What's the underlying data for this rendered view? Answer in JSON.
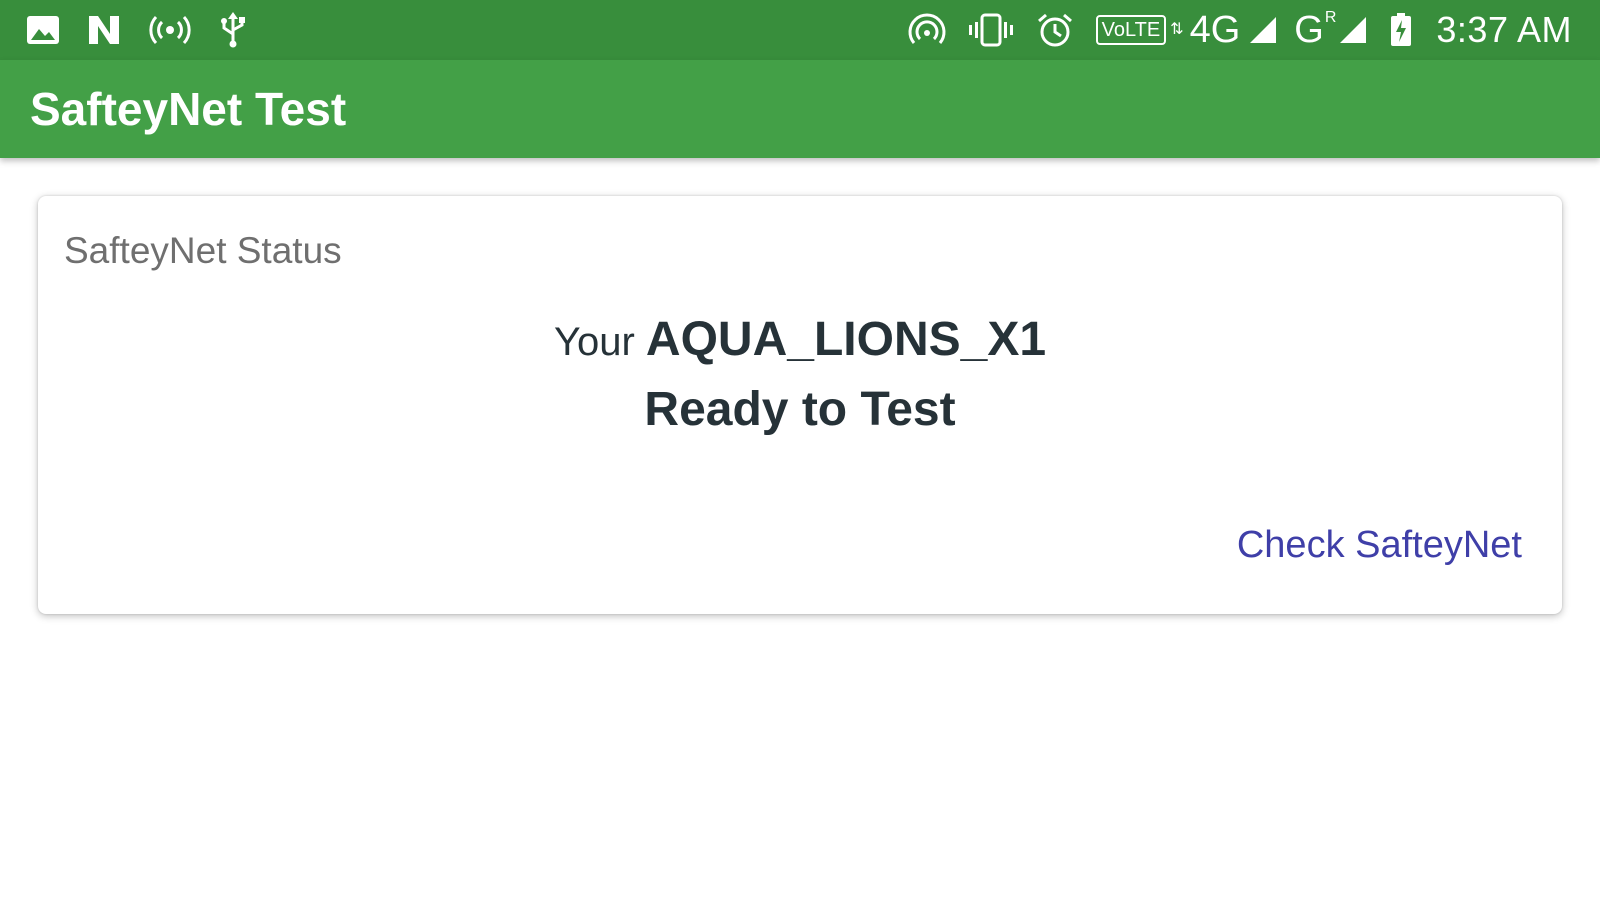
{
  "status_bar": {
    "left_icons": [
      "image-icon",
      "nfc-icon",
      "hotspot-icon",
      "usb-icon"
    ],
    "right_icons": [
      "hotspot-alt-icon",
      "vibrate-icon",
      "alarm-icon"
    ],
    "volte": "VoLTE",
    "network_4g": "4G",
    "network_g": "G",
    "roaming": "R",
    "time": "3:37 AM"
  },
  "toolbar": {
    "title": "SafteyNet Test"
  },
  "card": {
    "title": "SafteyNet Status",
    "prefix": "Your",
    "device": "AQUA_LIONS_X1",
    "status": "Ready to Test",
    "action_label": "Check SafteyNet"
  },
  "colors": {
    "status_bar": "#388e3c",
    "toolbar": "#43a047",
    "action": "#3f3fa8",
    "text_dark": "#263238"
  }
}
